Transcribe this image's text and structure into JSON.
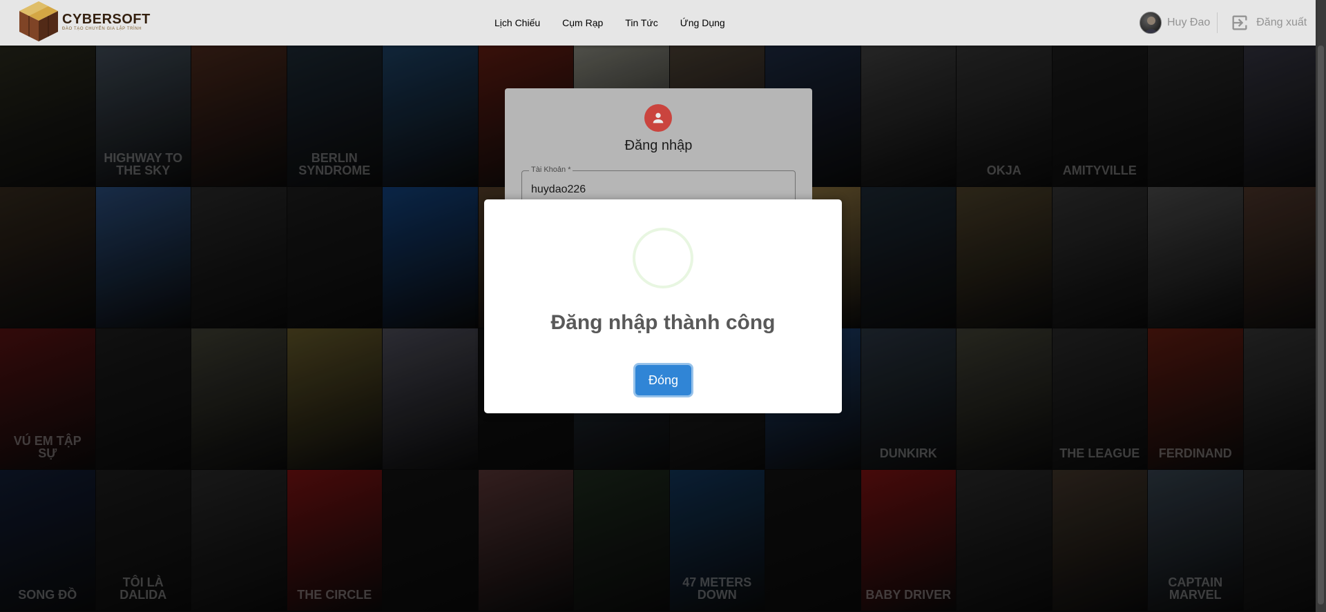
{
  "brand": {
    "name": "CYBERSOFT",
    "tagline": "ĐÀO TẠO CHUYÊN GIA LẬP TRÌNH"
  },
  "nav": {
    "items": [
      {
        "label": "Lịch Chiếu"
      },
      {
        "label": "Cụm Rạp"
      },
      {
        "label": "Tin Tức"
      },
      {
        "label": "Ứng Dụng"
      }
    ]
  },
  "user": {
    "name": "Huy Đao",
    "logout_label": "Đăng xuất"
  },
  "login_form": {
    "title": "Đăng nhập",
    "username_label": "Tài Khoản *",
    "username_value": "huydao226"
  },
  "modal": {
    "title": "Đăng nhập thành công",
    "button_label": "Đóng"
  },
  "background": {
    "posters": [
      {
        "text": "",
        "color": "#3a3a2a"
      },
      {
        "text": "HIGHWAY TO THE SKY",
        "color": "#5a6a7a"
      },
      {
        "text": "",
        "color": "#6a3a2a"
      },
      {
        "text": "BERLIN SYNDROME",
        "color": "#2a3a4a"
      },
      {
        "text": "",
        "color": "#2a5a8a"
      },
      {
        "text": "",
        "color": "#8a2a1a"
      },
      {
        "text": "",
        "color": "#c0c0b0"
      },
      {
        "text": "",
        "color": "#6a5a4a"
      },
      {
        "text": "",
        "color": "#2a3a5a"
      },
      {
        "text": "",
        "color": "#5a5a5a"
      },
      {
        "text": "okja",
        "color": "#4a4a4a"
      },
      {
        "text": "AMITYVILLE",
        "color": "#2a2a2a"
      },
      {
        "text": "",
        "color": "#3a3a3a"
      },
      {
        "text": "",
        "color": "#4a4a5a"
      },
      {
        "text": "",
        "color": "#4a3a2a"
      },
      {
        "text": "",
        "color": "#3a6aaa"
      },
      {
        "text": "",
        "color": "#3a3a3a"
      },
      {
        "text": "",
        "color": "#2a2a2a"
      },
      {
        "text": "",
        "color": "#1a5aaa"
      },
      {
        "text": "",
        "color": "#7a5a3a"
      },
      {
        "text": "",
        "color": "#4a4a4a"
      },
      {
        "text": "",
        "color": "#8a8a8a"
      },
      {
        "text": "",
        "color": "#caa55a"
      },
      {
        "text": "",
        "color": "#2a3a4a"
      },
      {
        "text": "",
        "color": "#6a5a3a"
      },
      {
        "text": "",
        "color": "#4a4a4a"
      },
      {
        "text": "",
        "color": "#6a6a6a"
      },
      {
        "text": "",
        "color": "#6a4a3a"
      },
      {
        "text": "VÚ EM TẬP SỰ",
        "color": "#7a1a1a"
      },
      {
        "text": "",
        "color": "#2a2a2a"
      },
      {
        "text": "",
        "color": "#5a5a4a"
      },
      {
        "text": "",
        "color": "#8a7a3a"
      },
      {
        "text": "",
        "color": "#6a6a7a"
      },
      {
        "text": "",
        "color": "#1a1a1a"
      },
      {
        "text": "",
        "color": "#3a4a5a"
      },
      {
        "text": "",
        "color": "#3a3a3a"
      },
      {
        "text": "",
        "color": "#2a5a9a"
      },
      {
        "text": "DUNKIRK",
        "color": "#3a4a5a"
      },
      {
        "text": "",
        "color": "#5a5a4a"
      },
      {
        "text": "THE LEAGUE",
        "color": "#3a3a3a"
      },
      {
        "text": "FERDINAND",
        "color": "#8a2a1a"
      },
      {
        "text": "",
        "color": "#4a4a4a"
      },
      {
        "text": "SONG ĐỒ",
        "color": "#1a2a4a"
      },
      {
        "text": "TÔI LÀ DALIDA",
        "color": "#2a2a2a"
      },
      {
        "text": "",
        "color": "#3a3a3a"
      },
      {
        "text": "THE CIRCLE",
        "color": "#aa1a1a"
      },
      {
        "text": "",
        "color": "#1a1a1a"
      },
      {
        "text": "",
        "color": "#7a4a4a"
      },
      {
        "text": "",
        "color": "#2a3a2a"
      },
      {
        "text": "47 METERS DOWN",
        "color": "#1a4a7a"
      },
      {
        "text": "",
        "color": "#1a1a1a"
      },
      {
        "text": "BABY DRIVER",
        "color": "#aa1a1a"
      },
      {
        "text": "",
        "color": "#3a3a3a"
      },
      {
        "text": "",
        "color": "#5a4a3a"
      },
      {
        "text": "CAPTAIN MARVEL",
        "color": "#4a5a6a"
      },
      {
        "text": "",
        "color": "#3a3a3a"
      }
    ]
  }
}
